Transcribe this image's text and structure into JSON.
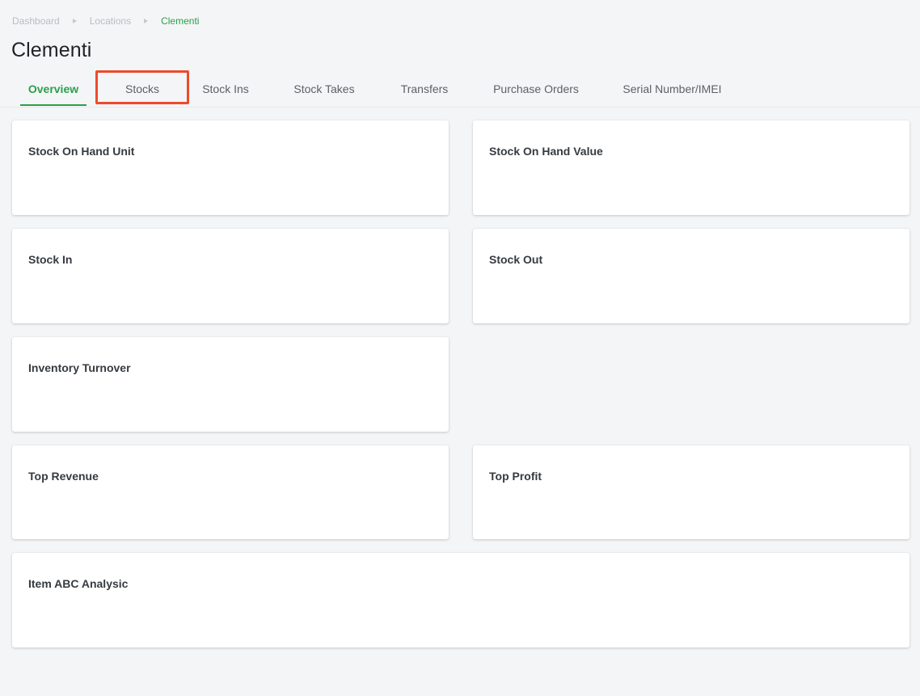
{
  "breadcrumb": {
    "items": [
      {
        "label": "Dashboard"
      },
      {
        "label": "Locations"
      },
      {
        "label": "Clementi"
      }
    ]
  },
  "page": {
    "title": "Clementi"
  },
  "tabs": [
    {
      "label": "Overview",
      "active": true
    },
    {
      "label": "Stocks",
      "highlighted": true
    },
    {
      "label": "Stock Ins"
    },
    {
      "label": "Stock Takes"
    },
    {
      "label": "Transfers"
    },
    {
      "label": "Purchase Orders"
    },
    {
      "label": "Serial Number/IMEI"
    }
  ],
  "cards": {
    "stock_on_hand_unit": {
      "title": "Stock On Hand Unit"
    },
    "stock_on_hand_value": {
      "title": "Stock On Hand Value"
    },
    "stock_in": {
      "title": "Stock In"
    },
    "stock_out": {
      "title": "Stock Out"
    },
    "inventory_turnover": {
      "title": "Inventory Turnover"
    },
    "top_revenue": {
      "title": "Top Revenue"
    },
    "top_profit": {
      "title": "Top Profit"
    },
    "item_abc_analysis": {
      "title": "Item ABC Analysic"
    }
  },
  "colors": {
    "accent": "#2aa04a",
    "highlight": "#ee4a2a",
    "background": "#f4f5f7"
  }
}
